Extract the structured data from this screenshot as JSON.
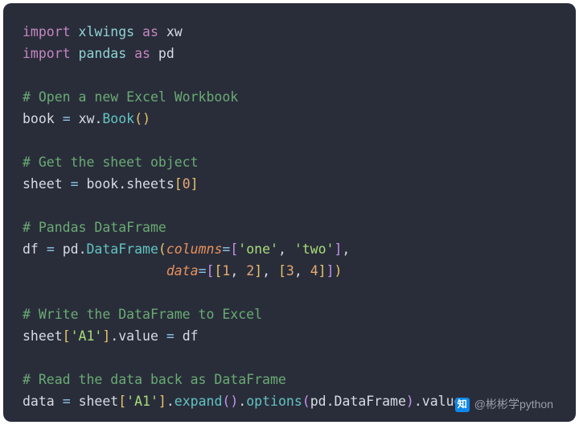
{
  "code": {
    "l01": {
      "kw1": "import",
      "mod1": "xlwings",
      "as": "as",
      "alias1": "xw"
    },
    "l02": {
      "kw1": "import",
      "mod1": "pandas",
      "as": "as",
      "alias1": "pd"
    },
    "l04": {
      "comment": "# Open a new Excel Workbook"
    },
    "l05": {
      "v": "book",
      "eq": "=",
      "obj": "xw",
      "dot": ".",
      "call": "Book",
      "lp": "(",
      "rp": ")"
    },
    "l07": {
      "comment": "# Get the sheet object"
    },
    "l08": {
      "v": "sheet",
      "eq": "=",
      "obj": "book",
      "dot": ".",
      "prop": "sheets",
      "lb": "[",
      "idx": "0",
      "rb": "]"
    },
    "l10": {
      "comment": "# Pandas DataFrame"
    },
    "l11": {
      "v": "df",
      "eq": "=",
      "obj": "pd",
      "dot": ".",
      "call": "DataFrame",
      "lp": "(",
      "kw": "columns",
      "eq2": "=",
      "lb": "[",
      "s1": "'one'",
      "c1": ",",
      "s2": "'two'",
      "rb": "]",
      "c2": ","
    },
    "l12": {
      "indent": "                  ",
      "kw": "data",
      "eq": "=",
      "lb1": "[",
      "lb2": "[",
      "n1": "1",
      "c1": ",",
      "n2": "2",
      "rb1": "]",
      "c2": ",",
      "lb3": "[",
      "n3": "3",
      "c3": ",",
      "n4": "4",
      "rb2": "]",
      "rb3": "]",
      "rp": ")"
    },
    "l14": {
      "comment": "# Write the DataFrame to Excel"
    },
    "l15": {
      "obj": "sheet",
      "lb": "[",
      "s": "'A1'",
      "rb": "]",
      "dot": ".",
      "prop": "value",
      "eq": "=",
      "rhs": "df"
    },
    "l17": {
      "comment": "# Read the data back as DataFrame"
    },
    "l18": {
      "v": "data",
      "eq": "=",
      "obj": "sheet",
      "lb": "[",
      "s": "'A1'",
      "rb": "]",
      "dot1": ".",
      "call1": "expand",
      "lp1": "(",
      "rp1": ")",
      "dot2": ".",
      "call2": "options",
      "lp2": "(",
      "arg_obj": "pd",
      "dot3": ".",
      "arg_call": "DataFrame",
      "rp2": ")",
      "dot4": ".",
      "prop": "value"
    }
  },
  "caption": {
    "icon_text": "知",
    "text": "@彬彬学python"
  }
}
